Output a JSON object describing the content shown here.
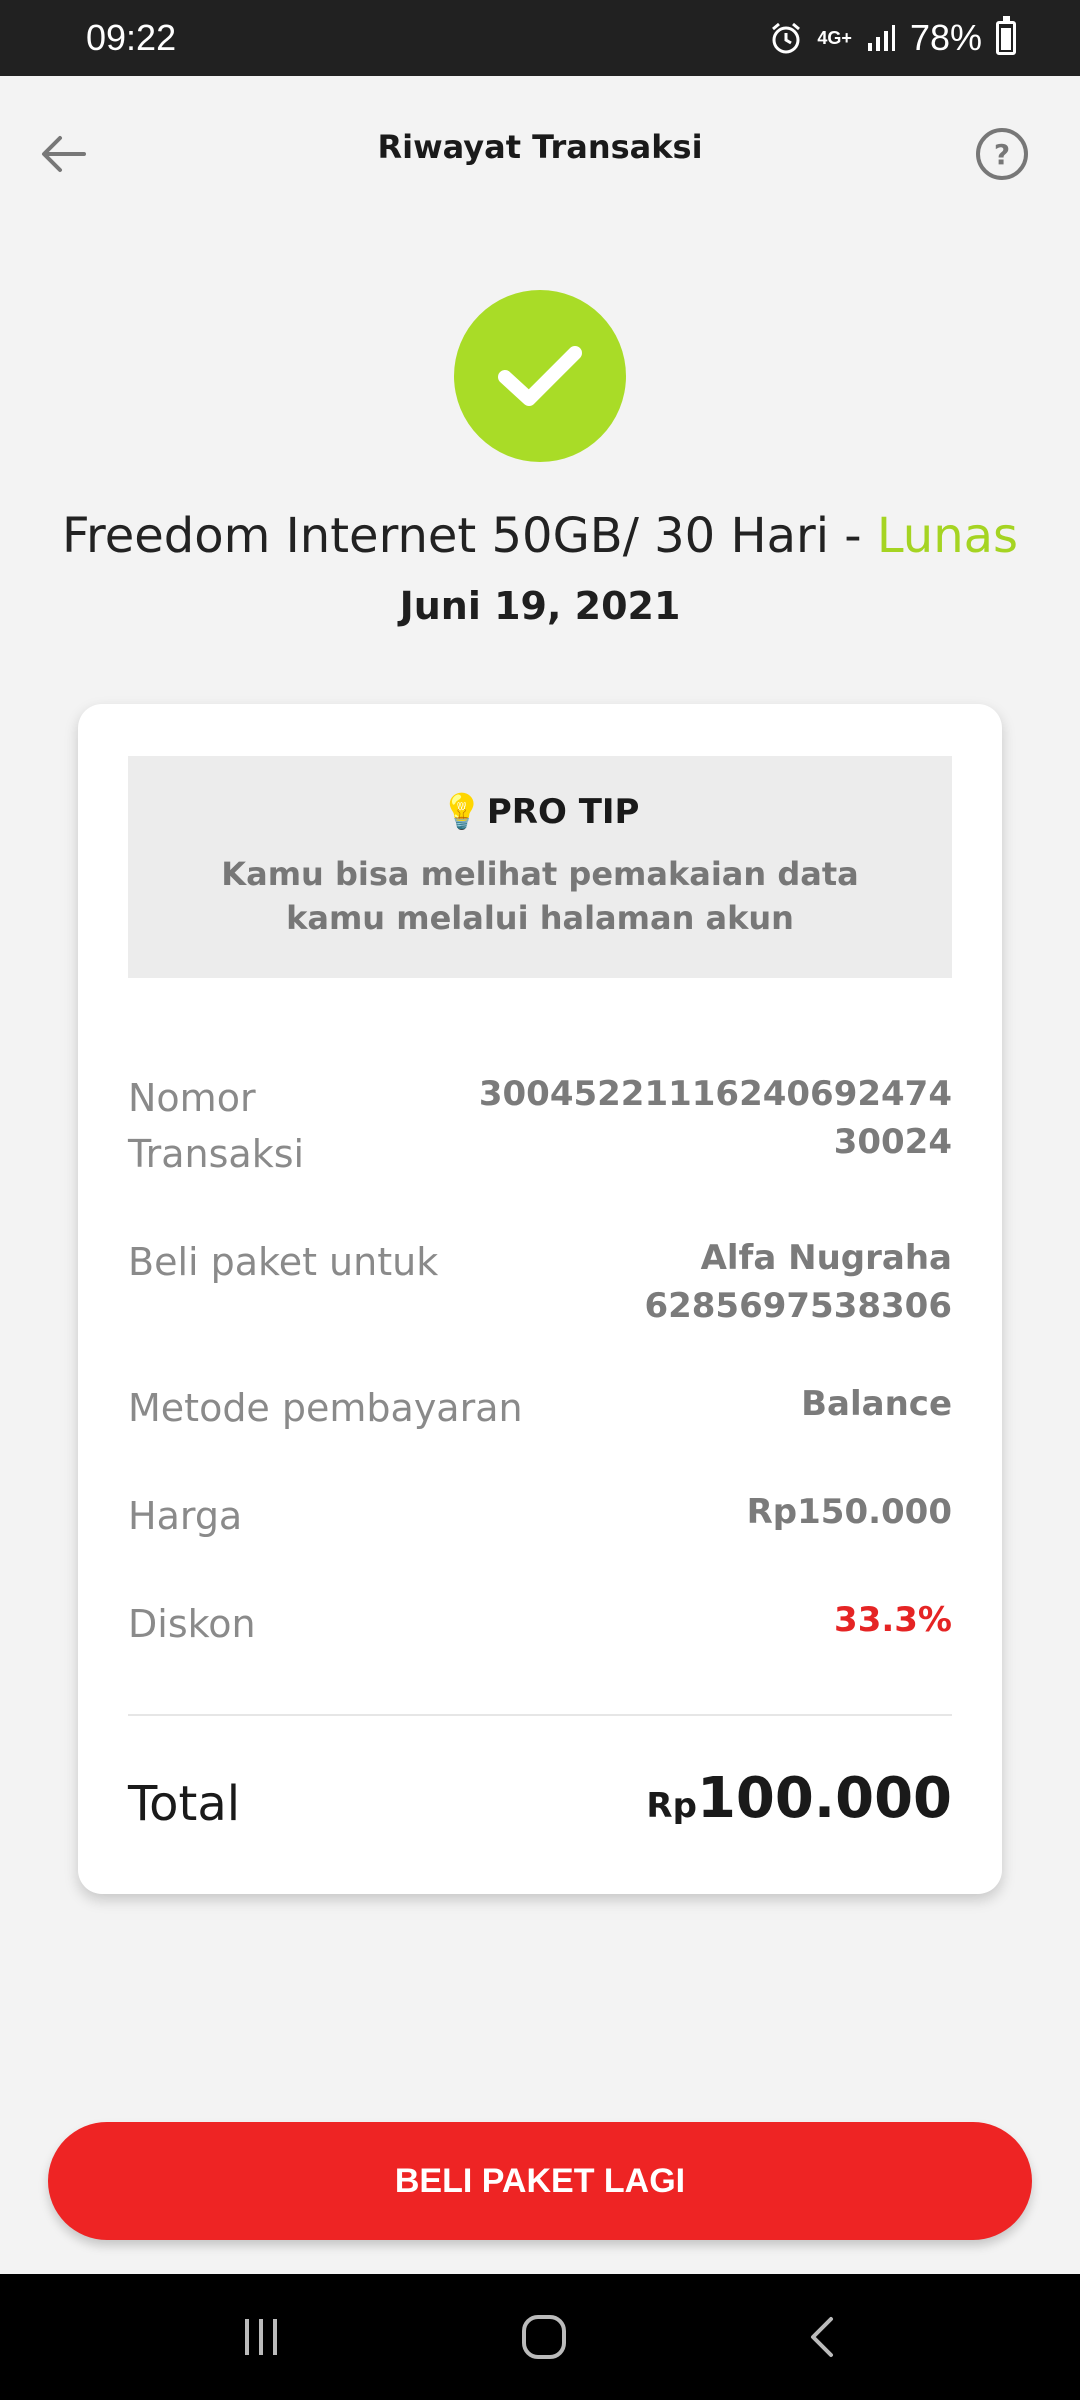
{
  "status_bar": {
    "time": "09:22",
    "network": "4G+",
    "battery": "78%"
  },
  "header": {
    "title": "Riwayat Transaksi"
  },
  "transaction": {
    "product": "Freedom Internet 50GB/ 30 Hari - ",
    "status": "Lunas",
    "date": "Juni 19, 2021"
  },
  "pro_tip": {
    "title": "PRO TIP",
    "text": "Kamu bisa melihat pemakaian data kamu melalui halaman akun"
  },
  "details": {
    "transaction_number_label": "Nomor Transaksi",
    "transaction_number_value": "30045221116240692474 30024",
    "recipient_label": "Beli paket untuk",
    "recipient_name": "Alfa Nugraha",
    "recipient_number": "6285697538306",
    "payment_method_label": "Metode pembayaran",
    "payment_method_value": "Balance",
    "price_label": "Harga",
    "price_value": "Rp150.000",
    "discount_label": "Diskon",
    "discount_value": "33.3%"
  },
  "total": {
    "label": "Total",
    "currency": "Rp",
    "amount": "100.000"
  },
  "cta": {
    "label": "BELI PAKET LAGI"
  },
  "colors": {
    "accent": "#ee2424",
    "success": "#a9dc27",
    "status_text": "#a5d422"
  }
}
